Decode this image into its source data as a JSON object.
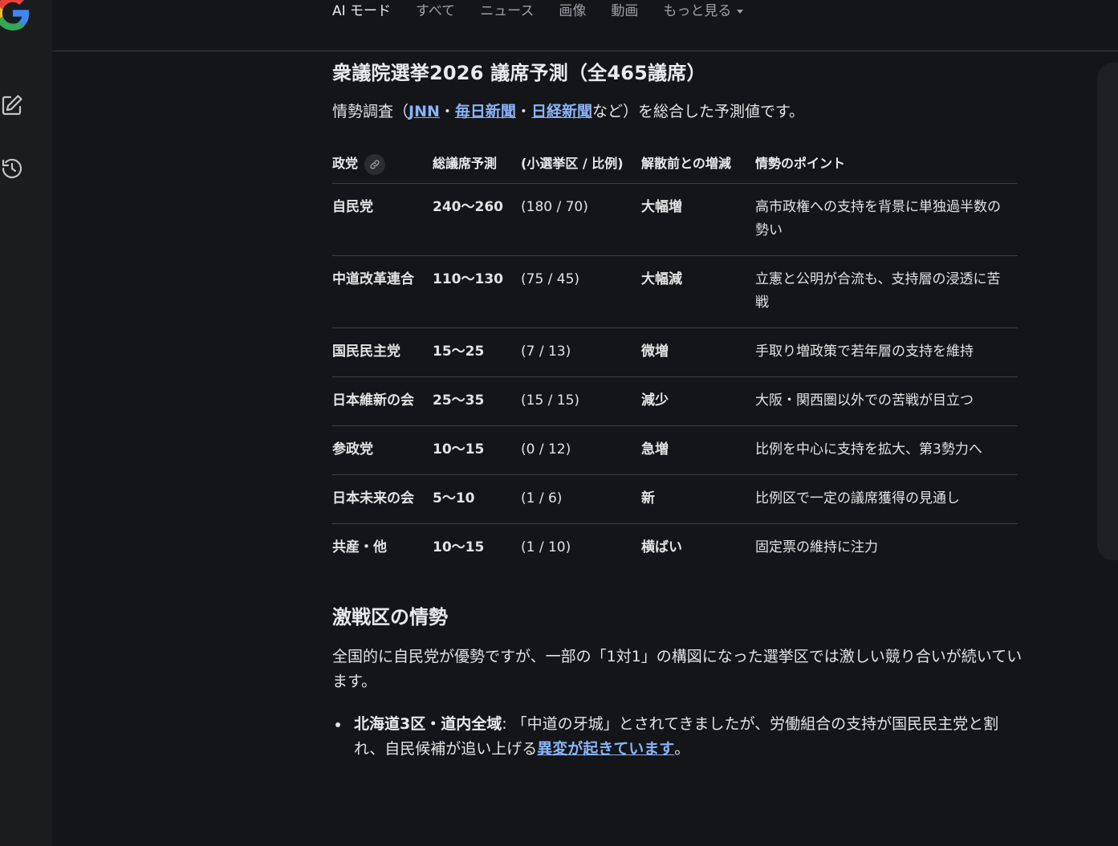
{
  "nav": {
    "tabs": [
      {
        "label": "AI モード",
        "active": true
      },
      {
        "label": "すべて"
      },
      {
        "label": "ニュース"
      },
      {
        "label": "画像"
      },
      {
        "label": "動画"
      },
      {
        "label": "もっと見る"
      }
    ]
  },
  "article": {
    "title": "衆議院選挙2026 議席予測（全465議席）",
    "lead_prefix": "情勢調査（",
    "sources": [
      "JNN",
      "毎日新聞",
      "日経新聞"
    ],
    "source_sep": "・",
    "lead_suffix": "など）を総合した予測値です。",
    "table": {
      "headers": [
        "政党",
        "総議席予測",
        "(小選挙区 / 比例)",
        "解散前との増減",
        "情勢のポイント"
      ],
      "rows": [
        {
          "party": "自民党",
          "total": "240〜260",
          "split": "(180 / 70)",
          "change": "大幅増",
          "point": "高市政権への支持を背景に単独過半数の勢い"
        },
        {
          "party": "中道改革連合",
          "total": "110〜130",
          "split": "(75 / 45)",
          "change": "大幅減",
          "point": "立憲と公明が合流も、支持層の浸透に苦戦"
        },
        {
          "party": "国民民主党",
          "total": "15〜25",
          "split": "(7 / 13)",
          "change": "微増",
          "point": "手取り増政策で若年層の支持を維持"
        },
        {
          "party": "日本維新の会",
          "total": "25〜35",
          "split": "(15 / 15)",
          "change": "減少",
          "point": "大阪・関西圏以外での苦戦が目立つ"
        },
        {
          "party": "参政党",
          "total": "10〜15",
          "split": "(0 / 12)",
          "change": "急増",
          "point": "比例を中心に支持を拡大、第3勢力へ"
        },
        {
          "party": "日本未来の会",
          "total": "5〜10",
          "split": "(1 / 6)",
          "change": "新",
          "point": "比例区で一定の議席獲得の見通し"
        },
        {
          "party": "共産・他",
          "total": "10〜15",
          "split": "(1 / 10)",
          "change": "横ばい",
          "point": "固定票の維持に注力"
        }
      ]
    },
    "section2": {
      "title": "激戦区の情勢",
      "body": "全国的に自民党が優勢ですが、一部の「1対1」の構図になった選挙区では激しい競り合いが続いています。",
      "bullets": [
        {
          "bold": "北海道3区・道内全域",
          "text": ": 「中道の牙城」とされてきましたが、労働組合の支持が国民民主党と割れ、自民候補が追い上げる",
          "link": "異変が起きています",
          "tail": "。"
        }
      ]
    }
  }
}
